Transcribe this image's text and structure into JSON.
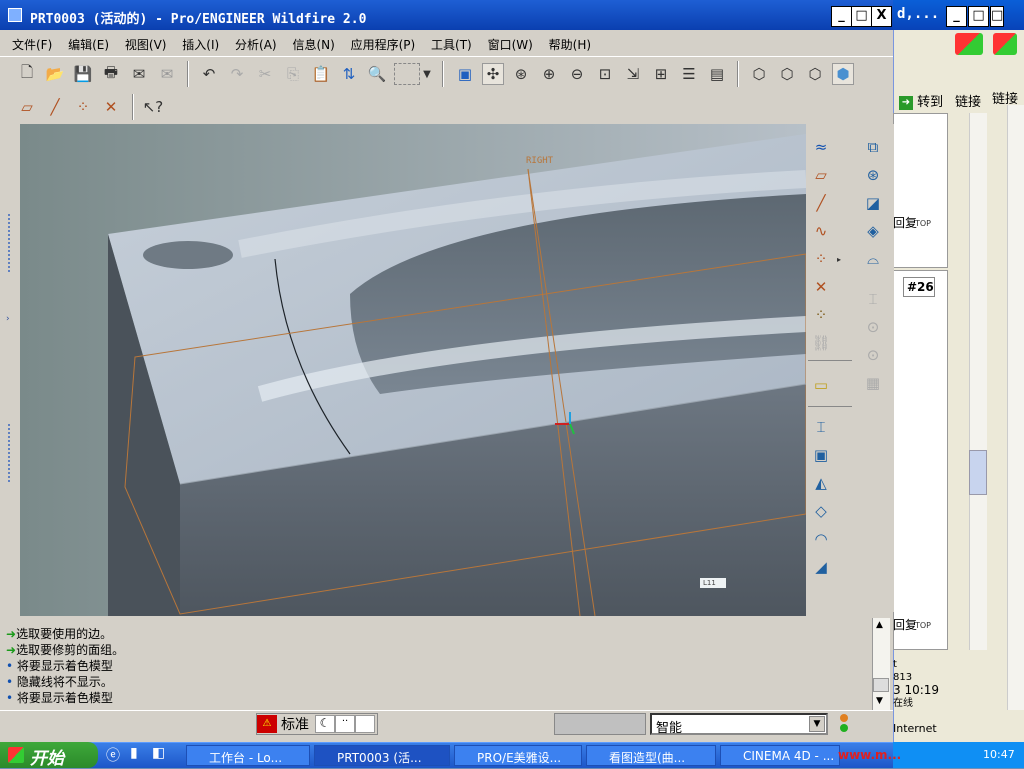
{
  "window": {
    "title": "PRT0003 (活动的) - Pro/ENGINEER Wildfire 2.0",
    "minimize_label": "_",
    "maximize_label": "□",
    "close_label": "X"
  },
  "background_window": {
    "title_fragment": "d,...",
    "goto_label": "转到",
    "links_label": "链接",
    "links_label2": "链接",
    "reply_label_1": "回复",
    "top_tag_1": "TOP",
    "post_number": "#26",
    "reply_label_2": "回复",
    "top_tag_2": "TOP",
    "text_line_1": "t",
    "text_line_2": "813",
    "text_line_3": "3 10:19",
    "text_line_4": "在线",
    "status_internet": "Internet"
  },
  "menu": [
    "文件(F)",
    "编辑(E)",
    "视图(V)",
    "插入(I)",
    "分析(A)",
    "信息(N)",
    "应用程序(P)",
    "工具(T)",
    "窗口(W)",
    "帮助(H)"
  ],
  "viewport": {
    "datum_label": "RIGHT",
    "small_tag": "L11"
  },
  "messages": [
    {
      "icon": "green-arrow",
      "text": "选取要使用的边。"
    },
    {
      "icon": "green-arrow",
      "text": "选取要修剪的面组。"
    },
    {
      "icon": "bullet",
      "text": "将要显示着色模型"
    },
    {
      "icon": "bullet",
      "text": "隐藏线将不显示。"
    },
    {
      "icon": "bullet",
      "text": "将要显示着色模型"
    }
  ],
  "statusbar": {
    "standard_label": "标准",
    "filter_value": "智能"
  },
  "taskbar": {
    "start_label": "开始",
    "items": [
      "工作台 - Lo...",
      "PRT0003 (活...",
      "PRO/E美雅设...",
      "看图造型(曲...",
      "CINEMA 4D - ..."
    ],
    "tray_text": "www.m...",
    "clock": "10:47"
  },
  "colors": {
    "title_blue": "#0a3fb0",
    "taskbar_blue": "#1d56c8",
    "start_green": "#2b8a2a",
    "datum_orange": "#b8763a",
    "model_top": "#b8c4d2",
    "model_side": "#5d6670"
  }
}
